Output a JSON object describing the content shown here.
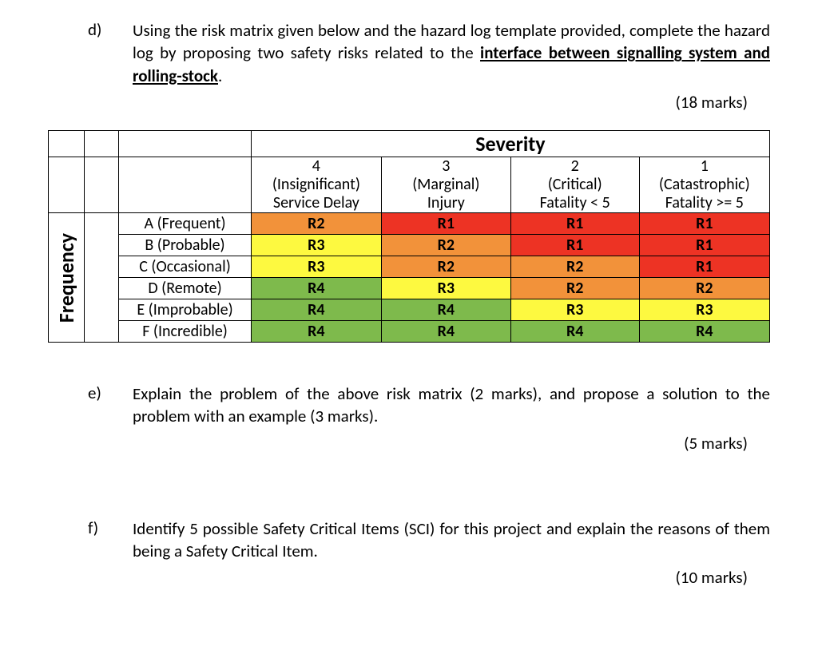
{
  "colors": {
    "red": "#ed3324",
    "orange": "#f2923a",
    "yellow": "#fdf940",
    "green": "#7eba4c"
  },
  "questions": {
    "d": {
      "letter": "d)",
      "text_pre": "Using the risk matrix given below and the hazard log template provided, complete the hazard log by proposing two safety risks related to the ",
      "text_ul": "interface between signalling system and rolling-stock",
      "text_post": ".",
      "marks": "(18 marks)"
    },
    "e": {
      "letter": "e)",
      "text": "Explain the problem of the above risk matrix (2 marks), and propose a solution to the problem with an example (3 marks).",
      "marks": "(5 marks)"
    },
    "f": {
      "letter": "f)",
      "text": "Identify 5 possible Safety Critical Items (SCI) for this project and explain the reasons of them being a Safety Critical Item.",
      "marks": "(10 marks)"
    }
  },
  "matrix": {
    "severity_title": "Severity",
    "frequency_title": "Frequency",
    "severity_cols": [
      {
        "num": "4",
        "label": "(Insignificant)",
        "detail": "Service Delay"
      },
      {
        "num": "3",
        "label": "(Marginal)",
        "detail": "Injury"
      },
      {
        "num": "2",
        "label": "(Critical)",
        "detail": "Fatality < 5"
      },
      {
        "num": "1",
        "label": "(Catastrophic)",
        "detail": "Fatality >= 5"
      }
    ],
    "rows": [
      {
        "label": "A (Frequent)",
        "cells": [
          {
            "v": "R2",
            "c": "orange"
          },
          {
            "v": "R1",
            "c": "red"
          },
          {
            "v": "R1",
            "c": "red"
          },
          {
            "v": "R1",
            "c": "red"
          }
        ]
      },
      {
        "label": "B (Probable)",
        "cells": [
          {
            "v": "R3",
            "c": "yellow"
          },
          {
            "v": "R2",
            "c": "orange"
          },
          {
            "v": "R1",
            "c": "red"
          },
          {
            "v": "R1",
            "c": "red"
          }
        ]
      },
      {
        "label": "C (Occasional)",
        "cells": [
          {
            "v": "R3",
            "c": "yellow"
          },
          {
            "v": "R2",
            "c": "orange"
          },
          {
            "v": "R2",
            "c": "orange"
          },
          {
            "v": "R1",
            "c": "red"
          }
        ]
      },
      {
        "label": "D (Remote)",
        "cells": [
          {
            "v": "R4",
            "c": "green"
          },
          {
            "v": "R3",
            "c": "yellow"
          },
          {
            "v": "R2",
            "c": "orange"
          },
          {
            "v": "R2",
            "c": "orange"
          }
        ]
      },
      {
        "label": "E (Improbable)",
        "cells": [
          {
            "v": "R4",
            "c": "green"
          },
          {
            "v": "R4",
            "c": "green"
          },
          {
            "v": "R3",
            "c": "yellow"
          },
          {
            "v": "R3",
            "c": "yellow"
          }
        ]
      },
      {
        "label": "F (Incredible)",
        "cells": [
          {
            "v": "R4",
            "c": "green"
          },
          {
            "v": "R4",
            "c": "green"
          },
          {
            "v": "R4",
            "c": "green"
          },
          {
            "v": "R4",
            "c": "green"
          }
        ]
      }
    ]
  }
}
